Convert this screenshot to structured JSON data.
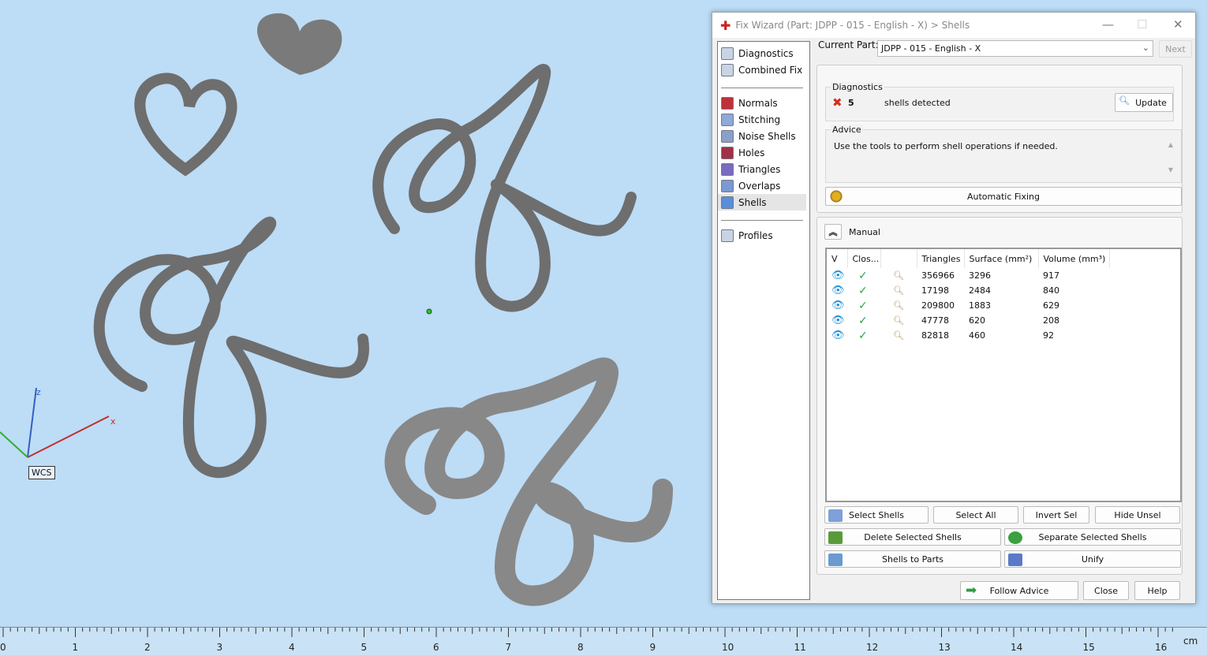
{
  "viewport": {
    "axis_x": "x",
    "axis_z": "z",
    "wcs_label": "WCS"
  },
  "ruler": {
    "unit": "cm",
    "ticks": [
      "0",
      "1",
      "2",
      "3",
      "4",
      "5",
      "6",
      "7",
      "8",
      "9",
      "10",
      "11",
      "12",
      "13",
      "14",
      "15",
      "16"
    ]
  },
  "dialog": {
    "title": "Fix Wizard (Part: JDPP - 015 - English - X) > Shells",
    "nav": {
      "top": [
        {
          "label": "Diagnostics",
          "icon": "magnifier-icon"
        },
        {
          "label": "Combined Fix",
          "icon": "combined-fix-icon"
        }
      ],
      "tools": [
        {
          "label": "Normals",
          "color": "#c0303a"
        },
        {
          "label": "Stitching",
          "color": "#8fa9d8"
        },
        {
          "label": "Noise Shells",
          "color": "#8aa0c8"
        },
        {
          "label": "Holes",
          "color": "#a03048"
        },
        {
          "label": "Triangles",
          "color": "#7a6ac0"
        },
        {
          "label": "Overlaps",
          "color": "#7a9ad0"
        },
        {
          "label": "Shells",
          "color": "#5a8ed8"
        }
      ],
      "bottom": [
        {
          "label": "Profiles"
        }
      ],
      "selected": "Shells"
    },
    "current_part_label": "Current Part:",
    "current_part_value": "JDPP - 015 - English - X",
    "next_label": "Next",
    "diagnostics": {
      "title": "Diagnostics",
      "count": "5",
      "text": "shells detected",
      "update_label": "Update"
    },
    "advice": {
      "title": "Advice",
      "text": "Use the tools to perform shell operations if needed."
    },
    "auto_fix_label": "Automatic Fixing",
    "manual_label": "Manual",
    "table": {
      "headers": [
        "V",
        "Clos...",
        "",
        "Triangles",
        "Surface (mm²)",
        "Volume (mm³)"
      ],
      "rows": [
        {
          "triangles": "356966",
          "surface": "3296",
          "volume": "917"
        },
        {
          "triangles": "17198",
          "surface": "2484",
          "volume": "840"
        },
        {
          "triangles": "209800",
          "surface": "1883",
          "volume": "629"
        },
        {
          "triangles": "47778",
          "surface": "620",
          "volume": "208"
        },
        {
          "triangles": "82818",
          "surface": "460",
          "volume": "92"
        }
      ]
    },
    "buttons": {
      "select_shells": "Select Shells",
      "select_all": "Select All",
      "invert_sel": "Invert Sel",
      "hide_unsel": "Hide Unsel",
      "delete_selected": "Delete Selected Shells",
      "separate_selected": "Separate Selected Shells",
      "shells_to_parts": "Shells to Parts",
      "unify": "Unify",
      "follow_advice": "Follow Advice",
      "close": "Close",
      "help": "Help"
    },
    "colors": {
      "accent": "#1a8fd8",
      "check": "#2aa64a",
      "error": "#d03020"
    }
  }
}
